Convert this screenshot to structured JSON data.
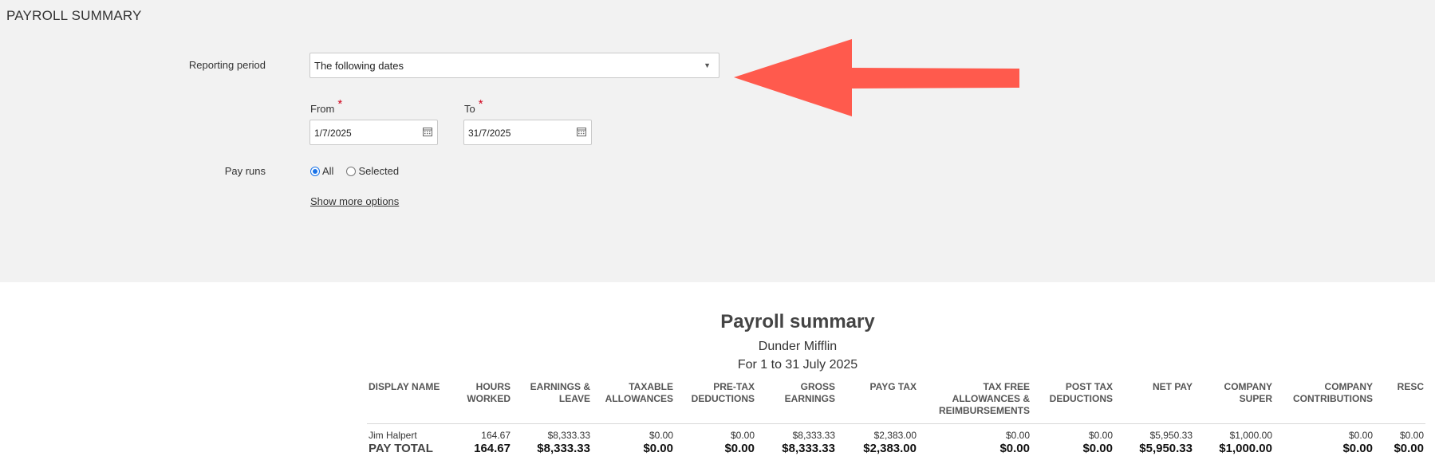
{
  "page": {
    "heading": "PAYROLL SUMMARY"
  },
  "form": {
    "reporting_period_label": "Reporting period",
    "reporting_period_value": "The following dates",
    "from_label": "From",
    "to_label": "To",
    "required_mark": "*",
    "from_value": "1/7/2025",
    "to_value": "31/7/2025",
    "pay_runs_label": "Pay runs",
    "pay_runs_options": [
      "All",
      "Selected"
    ],
    "pay_runs_selected": "All",
    "show_more": "Show more options"
  },
  "annotation": {
    "arrow_color": "#ff5a4d"
  },
  "report": {
    "title": "Payroll summary",
    "company": "Dunder Mifflin",
    "period": "For 1 to 31 July 2025",
    "columns": [
      "DISPLAY NAME",
      "HOURS WORKED",
      "EARNINGS & LEAVE",
      "TAXABLE ALLOWANCES",
      "PRE-TAX DEDUCTIONS",
      "GROSS EARNINGS",
      "PAYG TAX",
      "TAX FREE ALLOWANCES & REIMBURSEMENTS",
      "POST TAX DEDUCTIONS",
      "NET PAY",
      "COMPANY SUPER",
      "COMPANY CONTRIBUTIONS",
      "RESC"
    ],
    "rows": [
      [
        "Jim Halpert",
        "164.67",
        "$8,333.33",
        "$0.00",
        "$0.00",
        "$8,333.33",
        "$2,383.00",
        "$0.00",
        "$0.00",
        "$5,950.33",
        "$1,000.00",
        "$0.00",
        "$0.00"
      ]
    ],
    "total": [
      "PAY TOTAL",
      "164.67",
      "$8,333.33",
      "$0.00",
      "$0.00",
      "$8,333.33",
      "$2,383.00",
      "$0.00",
      "$0.00",
      "$5,950.33",
      "$1,000.00",
      "$0.00",
      "$0.00"
    ]
  }
}
